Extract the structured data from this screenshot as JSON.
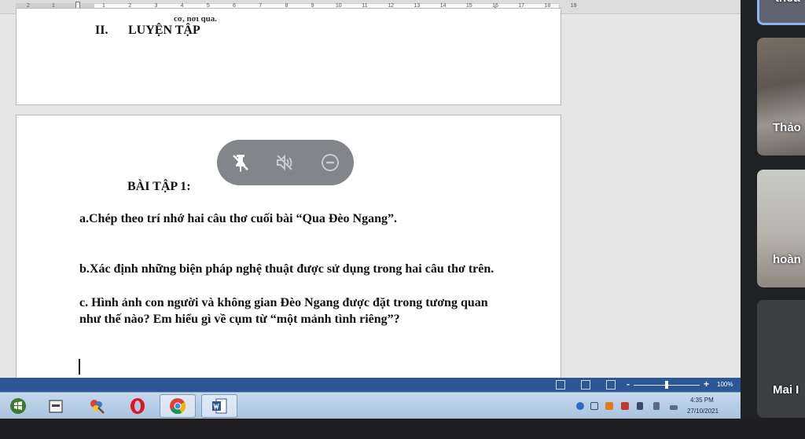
{
  "ruler": {
    "numbers": [
      "2",
      "1",
      "1",
      "2",
      "3",
      "4",
      "5",
      "6",
      "7",
      "8",
      "9",
      "10",
      "11",
      "12",
      "13",
      "14",
      "15",
      "16",
      "17",
      "18",
      "19"
    ]
  },
  "document": {
    "prev_line_fragment": "cơ, nơi qua.",
    "section_heading_num": "II.",
    "section_heading_text": "LUYỆN TẬP",
    "exercise_title": "BÀI TẬP 1:",
    "question_a": "a.Chép theo trí nhớ hai câu thơ cuối bài “Qua Đèo Ngang”.",
    "question_b": "b.Xác định những biện pháp nghệ thuật được sử dụng trong hai câu thơ trên.",
    "question_c": "c. Hình ảnh con người và không gian Đèo Ngang được đặt trong tương quan như thế nào? Em hiểu gì về cụm từ “một mảnh tình riêng”?"
  },
  "presenter_controls": {
    "icons": [
      "pin-off-icon",
      "mute-icon",
      "remove-icon"
    ]
  },
  "statusbar": {
    "zoom_minus": "-",
    "zoom_plus": "+",
    "zoom_value": "100%",
    "zoom_level": 0.5
  },
  "taskbar": {
    "apps": [
      "start-icon",
      "explorer-icon",
      "paint-icon",
      "opera-icon",
      "chrome-icon",
      "word-icon"
    ],
    "clock_time": "4:35 PM",
    "clock_date": "27/10/2021"
  },
  "participants": [
    {
      "name": "thoa"
    },
    {
      "name": "Thảo"
    },
    {
      "name": "hoàn"
    },
    {
      "name": "Mai I"
    }
  ],
  "colors": {
    "word_blue": "#2b5797",
    "active_speaker": "#8ab4f8",
    "meet_dark": "#202124"
  }
}
